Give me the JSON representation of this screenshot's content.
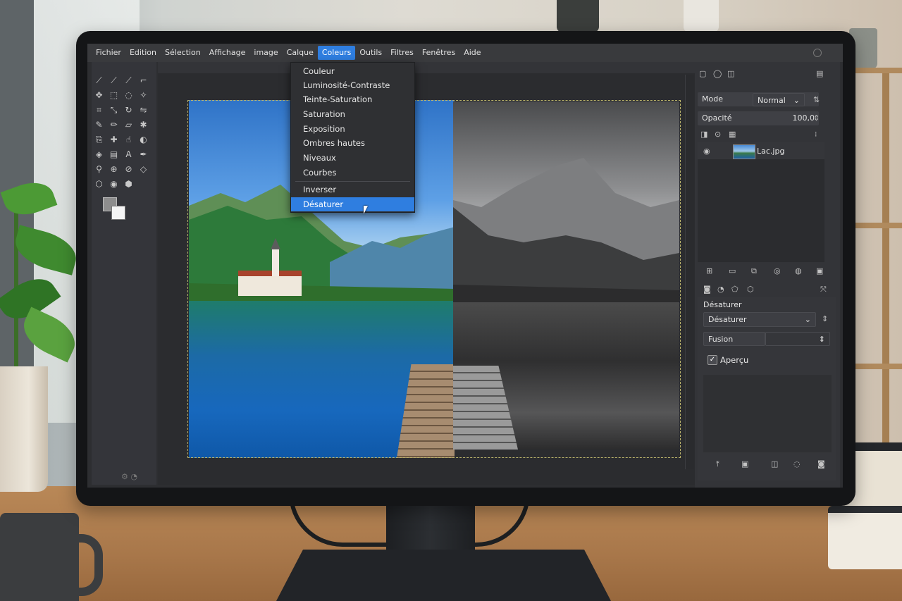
{
  "menubar": {
    "items": [
      "Fichier",
      "Edition",
      "Sélection",
      "Affichage",
      "image",
      "Calque",
      "Coleurs",
      "Outils",
      "Filtres",
      "Fenêtres",
      "Aide"
    ],
    "active_index": 6
  },
  "colors_menu": {
    "items": [
      "Couleur",
      "Luminosité-Contraste",
      "Teinte-Saturation",
      "Saturation",
      "Exposition",
      "Ombres hautes",
      "Niveaux",
      "Courbes",
      "Inverser",
      "Désaturer"
    ],
    "highlighted": "Désaturer"
  },
  "layers_panel": {
    "mode_label": "Mode",
    "mode_value": "Normal",
    "opacity_label": "Opacité",
    "opacity_value": "100,0",
    "layer_name": "Lac.jpg"
  },
  "tool_options": {
    "title": "Désaturer",
    "method_value": "Désaturer",
    "blend_value": "Fusion",
    "preview_label": "Aperçu",
    "preview_checked": true
  },
  "icons": [
    "chevron-down-icon",
    "eye-icon",
    "checkmark-icon",
    "pointer-cursor-icon"
  ],
  "accent_color": "#2f7ee0"
}
